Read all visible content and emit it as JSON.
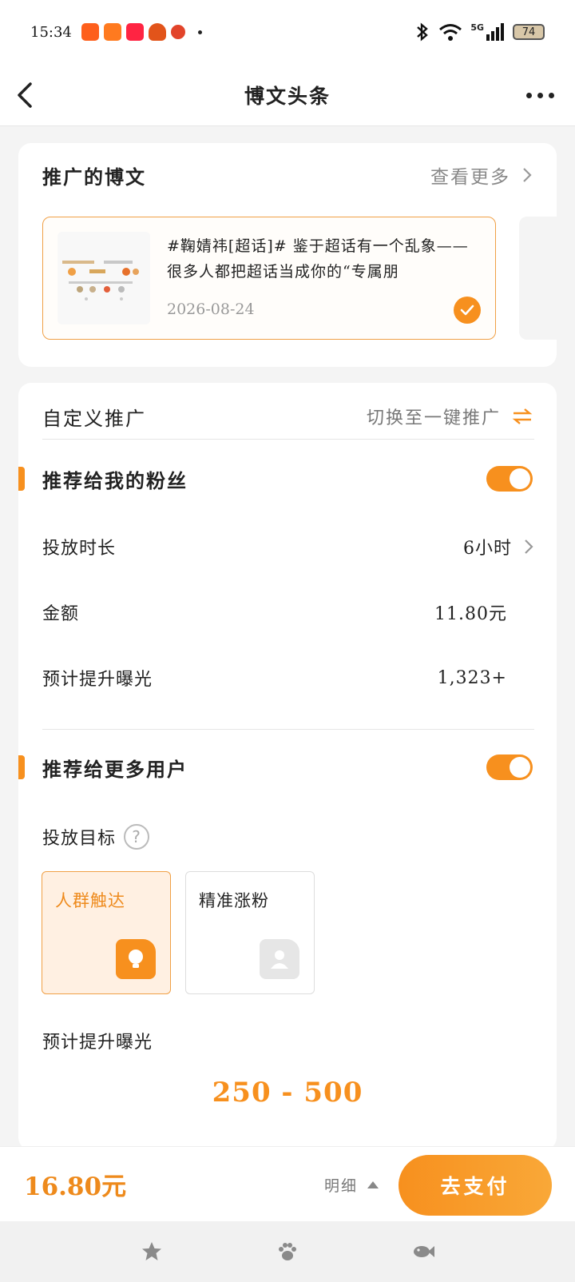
{
  "status_bar": {
    "time": "15:34",
    "network": "5G",
    "battery": "74"
  },
  "nav": {
    "title": "博文头条"
  },
  "promoted": {
    "title": "推广的博文",
    "more_label": "查看更多",
    "post": {
      "text": "#鞠婧祎[超话]# 鉴于超话有一个乱象——很多人都把超话当成你的“专属朋",
      "date": "2026-08-24"
    }
  },
  "custom": {
    "title": "自定义推广",
    "switch_label": "切换至一键推广",
    "fans_section": {
      "title": "推荐给我的粉丝",
      "enabled": true,
      "duration_label": "投放时长",
      "duration_value": "6小时",
      "amount_label": "金额",
      "amount_value": "11.80元",
      "exposure_label": "预计提升曝光",
      "exposure_value": "1,323+"
    },
    "more_users_section": {
      "title": "推荐给更多用户",
      "enabled": true,
      "target_label": "投放目标",
      "help_icon": "?",
      "targets": [
        {
          "label": "人群触达",
          "selected": true
        },
        {
          "label": "精准涨粉",
          "selected": false
        }
      ],
      "exposure_label": "预计提升曝光",
      "exposure_value": "250 - 500"
    }
  },
  "payment": {
    "total": "16.80元",
    "detail_label": "明细",
    "pay_label": "去支付"
  },
  "colors": {
    "accent": "#f7901e",
    "accent_light": "#fff0e2"
  }
}
